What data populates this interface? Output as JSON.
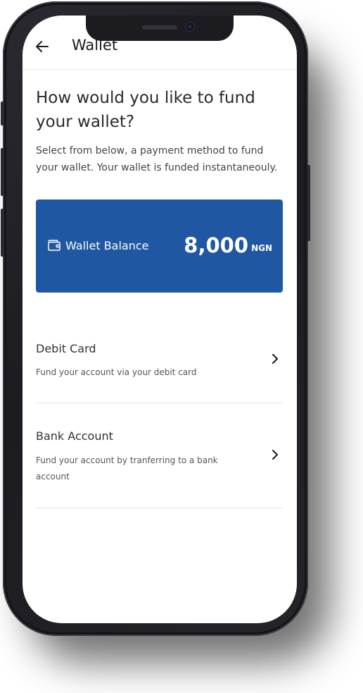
{
  "header": {
    "title": "Wallet",
    "back_icon": "arrow-left-icon"
  },
  "main": {
    "heading": "How would you like to fund your wallet?",
    "subtext": "Select from below, a payment method to fund your wallet. Your wallet is funded instantaneouly."
  },
  "balance": {
    "icon": "wallet-icon",
    "label": "Wallet Balance",
    "amount": "8,000",
    "currency": "NGN",
    "card_color": "#1f57a2"
  },
  "options": [
    {
      "title": "Debit Card",
      "description": "Fund your account via your debit card",
      "icon": "chevron-right-icon"
    },
    {
      "title": "Bank Account",
      "description": "Fund your account by tranferring to a bank account",
      "icon": "chevron-right-icon"
    }
  ]
}
